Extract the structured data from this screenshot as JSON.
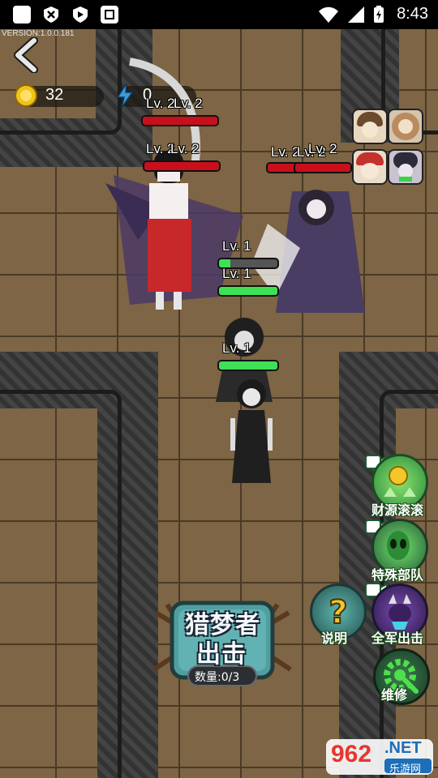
{
  "status_bar": {
    "time": "8:43",
    "left_icons": [
      "app-notification-icon",
      "close-badge-icon",
      "shield-icon",
      "square-app-icon"
    ],
    "right_icons": [
      "wifi-icon",
      "signal-icon",
      "battery-charging-icon"
    ]
  },
  "game": {
    "version": "VERSION:1.0.0.181",
    "resources": {
      "coins": "32",
      "energy": "0"
    },
    "enemy_levels": [
      "Lv. 2",
      "Lv. 2",
      "Lv. 2",
      "Lv. 2",
      "Lv. 2",
      "Lv. 2",
      "Lv. 2"
    ],
    "ally_levels": [
      "Lv. 1",
      "Lv. 1",
      "Lv. 1"
    ],
    "ally_hp": [
      0.2,
      1.0,
      1.0
    ],
    "enemy_hp": [
      1.0,
      1.0,
      1.0,
      1.0
    ],
    "portraits": [
      "brown-hair-girl-portrait",
      "lion-mane-portrait",
      "red-hood-girl-portrait",
      "dark-horned-portrait"
    ],
    "actions": {
      "wealth": "财源滚滚",
      "special": "特殊部队",
      "all_attack": "全军出击",
      "info": "说明",
      "repair": "维修"
    },
    "launch": {
      "title_line1": "猎梦者",
      "title_line2": "出击",
      "count": "数量:0/3"
    },
    "watermark": {
      "number": "962",
      "suffix": ".NET",
      "site": "乐游网"
    }
  }
}
